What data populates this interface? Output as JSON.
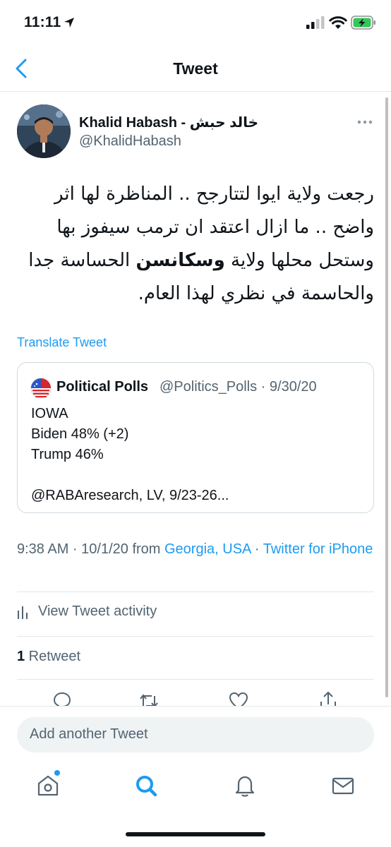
{
  "status_bar": {
    "time": "11:11"
  },
  "header": {
    "title": "Tweet"
  },
  "tweet": {
    "author_name": "Khalid Habash - خالد حبش",
    "author_handle": "@KhalidHabash",
    "text_before": "رجعت ولاية ايوا لتتارجح .. المناظرة لها اثر واضح .. ما ازال اعتقد ان ترمب سيفوز بها وستحل محلها ولاية ",
    "text_bold": "وسكانسن",
    "text_after": " الحساسة جدا والحاسمة في نظري لهذا العام.",
    "translate_label": "Translate Tweet"
  },
  "quote": {
    "name": "Political Polls",
    "meta": "@Politics_Polls · 9/30/20",
    "lines": [
      "IOWA",
      "Biden 48% (+2)",
      "Trump 46%",
      "",
      "@RABAresearch, LV, 9/23-26..."
    ]
  },
  "meta": {
    "time_date": "9:38 AM · 10/1/20 from ",
    "location": "Georgia, USA",
    "separator": " · ",
    "source": "Twitter for iPhone"
  },
  "activity_label": "View Tweet activity",
  "retweets": {
    "count": "1",
    "label": " Retweet"
  },
  "composer": {
    "placeholder": "Add another Tweet"
  },
  "colors": {
    "accent": "#1d9bf0",
    "text": "#0f1419",
    "secondary": "#536471"
  },
  "icons": {
    "header": [
      "back-chevron-icon"
    ],
    "tweet": [
      "more-options-icon"
    ],
    "actions": [
      "reply-icon",
      "retweet-icon",
      "like-icon",
      "share-icon"
    ],
    "tabs": [
      "home-icon",
      "search-icon",
      "notifications-icon",
      "messages-icon"
    ]
  }
}
